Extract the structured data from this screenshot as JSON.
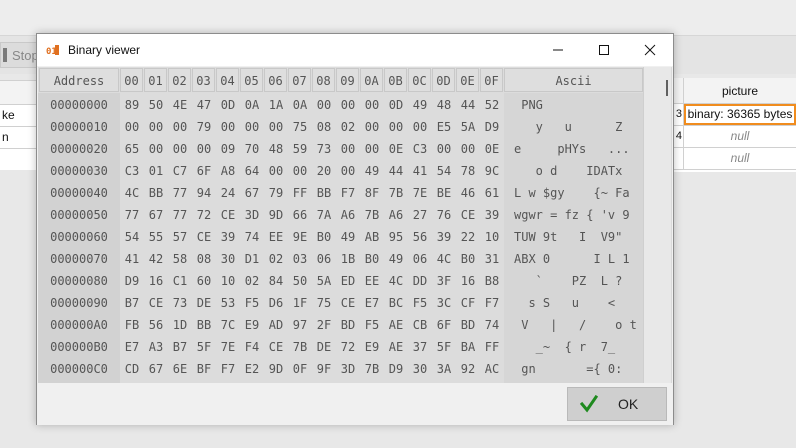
{
  "background": {
    "stop_label": "Stop",
    "left_rows": [
      "ke",
      "n"
    ],
    "right_header": "picture",
    "right_rows": [
      {
        "index": "3",
        "value": "binary: 36365 bytes",
        "kind": "selected"
      },
      {
        "index": "4",
        "value": "null",
        "kind": "null"
      },
      {
        "index": "",
        "value": "null",
        "kind": "null"
      }
    ]
  },
  "dialog": {
    "title": "Binary viewer",
    "icon": "binary-file-icon",
    "controls": [
      "minimize-icon",
      "maximize-icon",
      "close-icon"
    ],
    "ok_label": "OK",
    "accent_check": "#1f8a1f"
  },
  "hex": {
    "address_header": "Address",
    "ascii_header": "Ascii",
    "column_headers": [
      "00",
      "01",
      "02",
      "03",
      "04",
      "05",
      "06",
      "07",
      "08",
      "09",
      "0A",
      "0B",
      "0C",
      "0D",
      "0E",
      "0F"
    ],
    "rows": [
      {
        "address": "00000000",
        "bytes": [
          "89",
          "50",
          "4E",
          "47",
          "0D",
          "0A",
          "1A",
          "0A",
          "00",
          "00",
          "00",
          "0D",
          "49",
          "48",
          "44",
          "52"
        ],
        "ascii": " PNG"
      },
      {
        "address": "00000010",
        "bytes": [
          "00",
          "00",
          "00",
          "79",
          "00",
          "00",
          "00",
          "75",
          "08",
          "02",
          "00",
          "00",
          "00",
          "E5",
          "5A",
          "D9"
        ],
        "ascii": "   y   u      Z"
      },
      {
        "address": "00000020",
        "bytes": [
          "65",
          "00",
          "00",
          "00",
          "09",
          "70",
          "48",
          "59",
          "73",
          "00",
          "00",
          "0E",
          "C3",
          "00",
          "00",
          "0E"
        ],
        "ascii": "e     pHYs   ..."
      },
      {
        "address": "00000030",
        "bytes": [
          "C3",
          "01",
          "C7",
          "6F",
          "A8",
          "64",
          "00",
          "00",
          "20",
          "00",
          "49",
          "44",
          "41",
          "54",
          "78",
          "9C"
        ],
        "ascii": "   o d    IDATx"
      },
      {
        "address": "00000040",
        "bytes": [
          "4C",
          "BB",
          "77",
          "94",
          "24",
          "67",
          "79",
          "FF",
          "BB",
          "F7",
          "8F",
          "7B",
          "7E",
          "BE",
          "46",
          "61"
        ],
        "ascii": "L w $gy    {~ Fa"
      },
      {
        "address": "00000050",
        "bytes": [
          "77",
          "67",
          "77",
          "72",
          "CE",
          "3D",
          "9D",
          "66",
          "7A",
          "A6",
          "7B",
          "A6",
          "27",
          "76",
          "CE",
          "39"
        ],
        "ascii": "wgwr = fz { 'v 9"
      },
      {
        "address": "00000060",
        "bytes": [
          "54",
          "55",
          "57",
          "CE",
          "39",
          "74",
          "EE",
          "9E",
          "B0",
          "49",
          "AB",
          "95",
          "56",
          "39",
          "22",
          "10"
        ],
        "ascii": "TUW 9t   I  V9\""
      },
      {
        "address": "00000070",
        "bytes": [
          "41",
          "42",
          "58",
          "08",
          "30",
          "D1",
          "02",
          "03",
          "06",
          "1B",
          "B0",
          "49",
          "06",
          "4C",
          "B0",
          "31"
        ],
        "ascii": "ABX 0      I L 1"
      },
      {
        "address": "00000080",
        "bytes": [
          "D9",
          "16",
          "C1",
          "60",
          "10",
          "02",
          "84",
          "50",
          "5A",
          "ED",
          "EE",
          "4C",
          "DD",
          "3F",
          "16",
          "B8"
        ],
        "ascii": "   `    PZ  L ?"
      },
      {
        "address": "00000090",
        "bytes": [
          "B7",
          "CE",
          "73",
          "DE",
          "53",
          "F5",
          "D6",
          "1F",
          "75",
          "CE",
          "E7",
          "BC",
          "F5",
          "3C",
          "CF",
          "F7"
        ],
        "ascii": "  s S   u    <"
      },
      {
        "address": "000000A0",
        "bytes": [
          "FB",
          "56",
          "1D",
          "BB",
          "7C",
          "E9",
          "AD",
          "97",
          "2F",
          "BD",
          "F5",
          "AE",
          "CB",
          "6F",
          "BD",
          "74"
        ],
        "ascii": " V   |   /    o t"
      },
      {
        "address": "000000B0",
        "bytes": [
          "E7",
          "A3",
          "B7",
          "5F",
          "7E",
          "F4",
          "CE",
          "7B",
          "DE",
          "72",
          "E9",
          "AE",
          "37",
          "5F",
          "BA",
          "FF"
        ],
        "ascii": "   _~  { r  7_"
      },
      {
        "address": "000000C0",
        "bytes": [
          "CD",
          "67",
          "6E",
          "BF",
          "F7",
          "E2",
          "9D",
          "0F",
          "9F",
          "3D",
          "7B",
          "D9",
          "30",
          "3A",
          "92",
          "AC"
        ],
        "ascii": " gn       ={ 0:"
      }
    ]
  }
}
